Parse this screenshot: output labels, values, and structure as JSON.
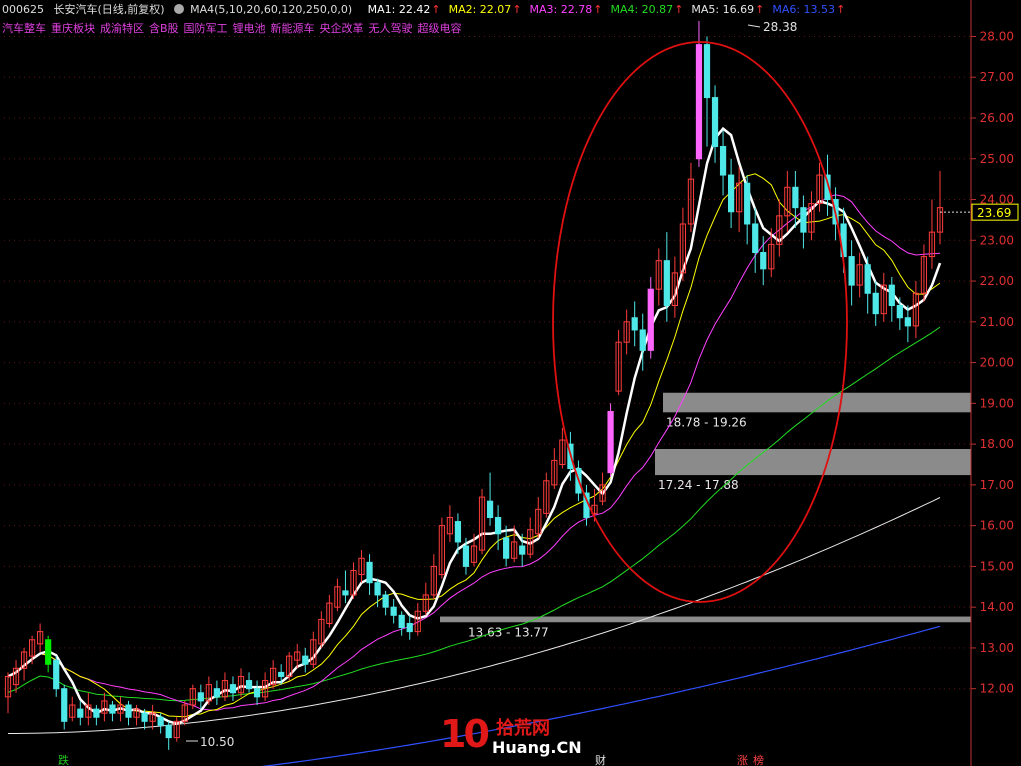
{
  "header": {
    "code": "000625",
    "name": "长安汽车(日线,前复权)",
    "ma_set": "MA4(5,10,20,60,120,250,0,0)",
    "mas": [
      {
        "label": "MA1: 22.42",
        "color": "#ffffff"
      },
      {
        "label": "MA2: 22.07",
        "color": "#ffff00"
      },
      {
        "label": "MA3: 22.78",
        "color": "#ff40ff"
      },
      {
        "label": "MA4: 20.87",
        "color": "#22dd22"
      },
      {
        "label": "MA5: 16.69",
        "color": "#e8e8e8"
      },
      {
        "label": "MA6: 13.53",
        "color": "#3050ff"
      }
    ]
  },
  "concepts": [
    "汽车整车",
    "重庆板块",
    "成渝特区",
    "含B股",
    "国防军工",
    "锂电池",
    "新能源车",
    "央企改革",
    "无人驾驶",
    "超级电容"
  ],
  "chart_data": {
    "type": "candlestick",
    "ylim": [
      10.3,
      28.6
    ],
    "yticks": [
      12,
      13,
      14,
      15,
      16,
      17,
      18,
      19,
      20,
      21,
      22,
      23,
      24,
      25,
      26,
      27,
      28
    ],
    "last_price": "23.69",
    "annotations": {
      "high": "28.38",
      "low": "10.50"
    },
    "gap_zones": [
      {
        "label": "18.78 - 19.26",
        "low": 18.78,
        "high": 19.26
      },
      {
        "label": "17.24 - 17.88",
        "low": 17.24,
        "high": 17.88
      },
      {
        "label": "13.63 - 13.77",
        "low": 13.63,
        "high": 13.77
      }
    ],
    "bottom_markers": [
      "跌",
      "财",
      "涨",
      "榜"
    ],
    "candles": [
      [
        11.8,
        12.3,
        11.4,
        12.4
      ],
      [
        12.1,
        12.5,
        11.9,
        12.7
      ],
      [
        12.5,
        12.9,
        12.2,
        13.0
      ],
      [
        12.8,
        13.2,
        12.6,
        13.3
      ],
      [
        13.1,
        13.4,
        12.9,
        13.6
      ],
      [
        13.2,
        12.6,
        12.4,
        13.3
      ],
      [
        12.7,
        12.0,
        11.8,
        12.8
      ],
      [
        12.0,
        11.2,
        11.0,
        12.1
      ],
      [
        11.3,
        11.6,
        11.2,
        11.8
      ],
      [
        11.5,
        11.3,
        11.1,
        11.7
      ],
      [
        11.3,
        11.6,
        11.1,
        11.9
      ],
      [
        11.5,
        11.3,
        11.1,
        11.6
      ],
      [
        11.4,
        11.7,
        11.2,
        11.9
      ],
      [
        11.6,
        11.4,
        11.2,
        11.7
      ],
      [
        11.4,
        11.6,
        11.2,
        11.8
      ],
      [
        11.6,
        11.3,
        11.1,
        11.7
      ],
      [
        11.3,
        11.5,
        11.1,
        11.6
      ],
      [
        11.4,
        11.2,
        11.0,
        11.5
      ],
      [
        11.2,
        11.4,
        11.0,
        11.6
      ],
      [
        11.3,
        11.1,
        10.9,
        11.4
      ],
      [
        11.1,
        10.8,
        10.5,
        11.2
      ],
      [
        10.8,
        11.2,
        10.7,
        11.3
      ],
      [
        11.2,
        11.6,
        11.1,
        11.7
      ],
      [
        11.6,
        12.0,
        11.5,
        12.1
      ],
      [
        11.9,
        11.7,
        11.5,
        12.1
      ],
      [
        11.7,
        12.1,
        11.6,
        12.3
      ],
      [
        12.0,
        11.8,
        11.6,
        12.2
      ],
      [
        11.8,
        12.2,
        11.7,
        12.4
      ],
      [
        12.1,
        11.9,
        11.7,
        12.3
      ],
      [
        11.9,
        12.3,
        11.8,
        12.5
      ],
      [
        12.2,
        12.0,
        11.9,
        12.4
      ],
      [
        12.0,
        11.8,
        11.6,
        12.2
      ],
      [
        11.8,
        12.2,
        11.7,
        12.4
      ],
      [
        12.1,
        12.5,
        12.0,
        12.7
      ],
      [
        12.4,
        12.3,
        12.1,
        12.6
      ],
      [
        12.3,
        12.8,
        12.2,
        12.9
      ],
      [
        12.7,
        12.9,
        12.5,
        13.1
      ],
      [
        12.8,
        12.6,
        12.4,
        13.0
      ],
      [
        12.6,
        13.2,
        12.5,
        13.4
      ],
      [
        13.1,
        13.7,
        13.0,
        13.9
      ],
      [
        13.6,
        14.1,
        13.5,
        14.3
      ],
      [
        14.0,
        14.5,
        13.9,
        14.7
      ],
      [
        14.4,
        14.3,
        14.1,
        14.9
      ],
      [
        14.3,
        14.9,
        14.2,
        15.1
      ],
      [
        14.8,
        15.2,
        14.6,
        15.4
      ],
      [
        15.1,
        14.6,
        14.3,
        15.3
      ],
      [
        14.6,
        14.3,
        14.0,
        14.7
      ],
      [
        14.3,
        14.0,
        13.8,
        14.4
      ],
      [
        14.0,
        13.8,
        13.6,
        14.2
      ],
      [
        13.8,
        13.5,
        13.3,
        13.9
      ],
      [
        13.6,
        13.4,
        13.2,
        13.8
      ],
      [
        13.4,
        13.9,
        13.3,
        14.1
      ],
      [
        13.9,
        14.3,
        13.8,
        14.6
      ],
      [
        14.3,
        15.0,
        14.2,
        15.3
      ],
      [
        14.8,
        16.0,
        14.7,
        16.2
      ],
      [
        15.8,
        16.2,
        15.6,
        16.5
      ],
      [
        16.1,
        15.6,
        15.3,
        16.3
      ],
      [
        15.5,
        15.0,
        14.8,
        15.7
      ],
      [
        15.1,
        15.5,
        15.0,
        15.8
      ],
      [
        15.4,
        16.7,
        15.3,
        16.9
      ],
      [
        16.6,
        16.2,
        16.0,
        17.3
      ],
      [
        16.2,
        15.8,
        15.4,
        16.5
      ],
      [
        15.7,
        15.2,
        15.0,
        16.0
      ],
      [
        15.2,
        15.6,
        15.1,
        16.0
      ],
      [
        15.5,
        15.3,
        15.0,
        15.8
      ],
      [
        15.3,
        15.9,
        15.2,
        16.2
      ],
      [
        15.8,
        16.4,
        15.7,
        16.7
      ],
      [
        16.3,
        17.1,
        16.2,
        17.3
      ],
      [
        17.0,
        17.6,
        16.9,
        17.9
      ],
      [
        17.5,
        18.1,
        17.4,
        18.4
      ],
      [
        18.0,
        17.4,
        17.1,
        18.3
      ],
      [
        17.4,
        16.8,
        16.6,
        17.6
      ],
      [
        16.8,
        16.2,
        16.0,
        17.0
      ],
      [
        16.3,
        16.5,
        16.1,
        16.9
      ],
      [
        16.6,
        17.0,
        16.5,
        17.3
      ],
      [
        17.3,
        18.8,
        17.2,
        19.0
      ],
      [
        19.3,
        20.5,
        19.2,
        20.8
      ],
      [
        20.5,
        21.0,
        20.2,
        21.3
      ],
      [
        21.1,
        20.8,
        20.4,
        21.5
      ],
      [
        20.8,
        20.3,
        19.8,
        21.2
      ],
      [
        20.3,
        21.8,
        20.1,
        22.1
      ],
      [
        21.8,
        22.5,
        21.4,
        22.8
      ],
      [
        22.5,
        21.4,
        21.0,
        23.2
      ],
      [
        21.4,
        22.2,
        21.1,
        22.6
      ],
      [
        22.2,
        23.4,
        22.0,
        23.8
      ],
      [
        23.4,
        24.5,
        23.2,
        24.9
      ],
      [
        25.0,
        27.8,
        24.8,
        28.38
      ],
      [
        27.8,
        26.5,
        25.3,
        28.0
      ],
      [
        26.5,
        25.3,
        24.9,
        26.8
      ],
      [
        25.3,
        24.6,
        24.1,
        25.7
      ],
      [
        24.6,
        23.7,
        23.3,
        25.0
      ],
      [
        23.7,
        24.4,
        23.2,
        24.8
      ],
      [
        24.4,
        23.4,
        22.9,
        24.6
      ],
      [
        23.4,
        22.7,
        22.2,
        23.8
      ],
      [
        22.7,
        22.3,
        21.9,
        23.1
      ],
      [
        22.3,
        22.9,
        22.1,
        23.3
      ],
      [
        22.9,
        23.6,
        22.6,
        24.0
      ],
      [
        23.6,
        24.3,
        23.2,
        24.7
      ],
      [
        24.3,
        23.8,
        23.3,
        24.7
      ],
      [
        23.8,
        23.2,
        22.8,
        24.1
      ],
      [
        23.2,
        23.9,
        23.0,
        24.2
      ],
      [
        23.9,
        24.6,
        23.7,
        24.9
      ],
      [
        24.6,
        24.0,
        23.6,
        25.1
      ],
      [
        24.0,
        23.4,
        23.0,
        24.3
      ],
      [
        23.4,
        22.6,
        22.2,
        23.8
      ],
      [
        22.6,
        21.9,
        21.4,
        23.0
      ],
      [
        21.9,
        22.4,
        21.6,
        22.7
      ],
      [
        22.4,
        21.7,
        21.2,
        22.6
      ],
      [
        21.7,
        21.2,
        20.9,
        22.0
      ],
      [
        21.2,
        21.9,
        21.0,
        22.2
      ],
      [
        21.9,
        21.4,
        21.0,
        22.1
      ],
      [
        21.4,
        21.1,
        20.8,
        21.6
      ],
      [
        21.1,
        20.9,
        20.5,
        21.4
      ],
      [
        20.9,
        21.7,
        20.6,
        22.0
      ],
      [
        21.7,
        22.6,
        21.5,
        22.9
      ],
      [
        22.6,
        23.2,
        22.3,
        24.0
      ],
      [
        23.2,
        23.8,
        22.9,
        24.7
      ]
    ]
  },
  "colors": {
    "up": "#ff3c3c",
    "down": "#4ee8e8",
    "axis": "#c03030",
    "grid": "#5a1414",
    "gap_zone": "#9a9a9a",
    "ellipse": "#e01010"
  },
  "logo": {
    "digits": "10",
    "cn": "拾荒网",
    "en": "Huang.CN"
  }
}
